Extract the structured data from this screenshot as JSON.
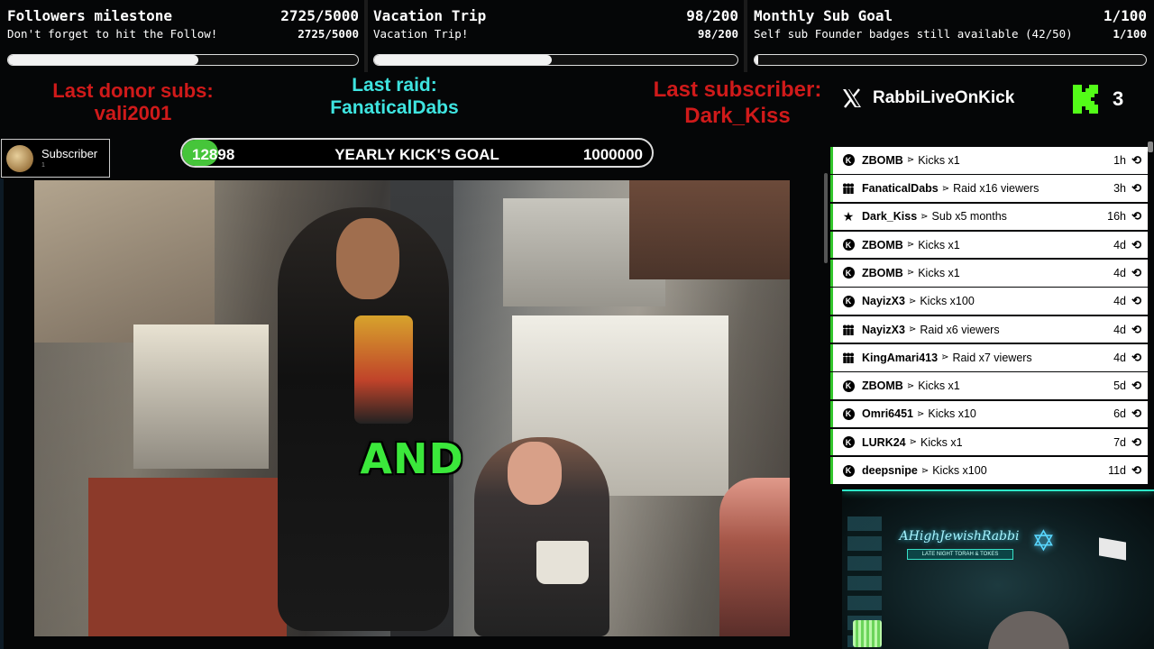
{
  "goals": [
    {
      "title": "Followers milestone",
      "count": "2725/5000",
      "subtitle": "Don't forget to hit the Follow!",
      "count2": "2725/5000",
      "progress": 0.545
    },
    {
      "title": "Vacation Trip",
      "count": "98/200",
      "subtitle": "Vacation Trip!",
      "count2": "98/200",
      "progress": 0.49
    },
    {
      "title": "Monthly Sub Goal",
      "count": "1/100",
      "subtitle": "Self sub Founder badges still available (42/50)",
      "count2": "1/100",
      "progress": 0.01
    }
  ],
  "last_donor": {
    "label": "Last donor subs:",
    "name": "vali2001"
  },
  "last_raid": {
    "label": "Last raid:",
    "name": "FanaticalDabs"
  },
  "last_subscriber": {
    "label": "Last subscriber:",
    "name": "Dark_Kiss"
  },
  "social": {
    "x_icon": "x-logo-icon",
    "handle": "RabbiLiveOnKick"
  },
  "kick": {
    "icon": "kick-logo-icon",
    "count": "3"
  },
  "subscriber_badge": {
    "label": "Subscriber",
    "sub": "1"
  },
  "yearly_goal": {
    "current": "12898",
    "label": "YEARLY KICK'S GOAL",
    "target": "1000000",
    "progress": 0.0129
  },
  "video": {
    "caption": "AND"
  },
  "events": [
    {
      "icon": "kick-coin-icon",
      "user": "ZBOMB",
      "action": "Kicks x1",
      "time": "1h"
    },
    {
      "icon": "raid-icon",
      "user": "FanaticalDabs",
      "action": "Raid x16 viewers",
      "time": "3h"
    },
    {
      "icon": "star-icon",
      "user": "Dark_Kiss",
      "action": "Sub x5 months",
      "time": "16h"
    },
    {
      "icon": "kick-coin-icon",
      "user": "ZBOMB",
      "action": "Kicks x1",
      "time": "4d"
    },
    {
      "icon": "kick-coin-icon",
      "user": "ZBOMB",
      "action": "Kicks x1",
      "time": "4d"
    },
    {
      "icon": "kick-coin-icon",
      "user": "NayizX3",
      "action": "Kicks x100",
      "time": "4d"
    },
    {
      "icon": "raid-icon",
      "user": "NayizX3",
      "action": "Raid x6 viewers",
      "time": "4d"
    },
    {
      "icon": "raid-icon",
      "user": "KingAmari413",
      "action": "Raid x7 viewers",
      "time": "4d"
    },
    {
      "icon": "kick-coin-icon",
      "user": "ZBOMB",
      "action": "Kicks x1",
      "time": "5d"
    },
    {
      "icon": "kick-coin-icon",
      "user": "Omri6451",
      "action": "Kicks x10",
      "time": "6d"
    },
    {
      "icon": "kick-coin-icon",
      "user": "LURK24",
      "action": "Kicks x1",
      "time": "7d"
    },
    {
      "icon": "kick-coin-icon",
      "user": "deepsnipe",
      "action": "Kicks x100",
      "time": "11d"
    }
  ],
  "webcam": {
    "brand": "AHighJewishRabbi",
    "tagline": "LATE NIGHT TORAH & TOKES"
  },
  "colors": {
    "accent_green": "#46c53a",
    "red": "#d01a1a",
    "cyan": "#3ee4e0"
  }
}
